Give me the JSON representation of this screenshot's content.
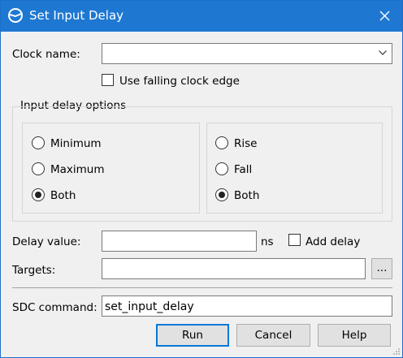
{
  "window": {
    "title": "Set Input Delay",
    "close_icon": "close-icon",
    "app_icon": "timing-app-icon",
    "accent": "#1e78d2"
  },
  "clock": {
    "label": "Clock name:",
    "value": "",
    "falling_edge_label": "Use falling clock edge",
    "falling_edge_checked": false
  },
  "options": {
    "group_label": "Input delay options",
    "minmax": [
      {
        "label": "Minimum",
        "selected": false
      },
      {
        "label": "Maximum",
        "selected": false
      },
      {
        "label": "Both",
        "selected": true
      }
    ],
    "risefall": [
      {
        "label": "Rise",
        "selected": false
      },
      {
        "label": "Fall",
        "selected": false
      },
      {
        "label": "Both",
        "selected": true
      }
    ]
  },
  "delay": {
    "label": "Delay value:",
    "value": "",
    "unit": "ns",
    "add_delay_label": "Add delay",
    "add_delay_checked": false
  },
  "targets": {
    "label": "Targets:",
    "value": "",
    "browse_label": "..."
  },
  "sdc": {
    "label": "SDC command:",
    "value": "set_input_delay"
  },
  "buttons": {
    "run": "Run",
    "cancel": "Cancel",
    "help": "Help"
  }
}
